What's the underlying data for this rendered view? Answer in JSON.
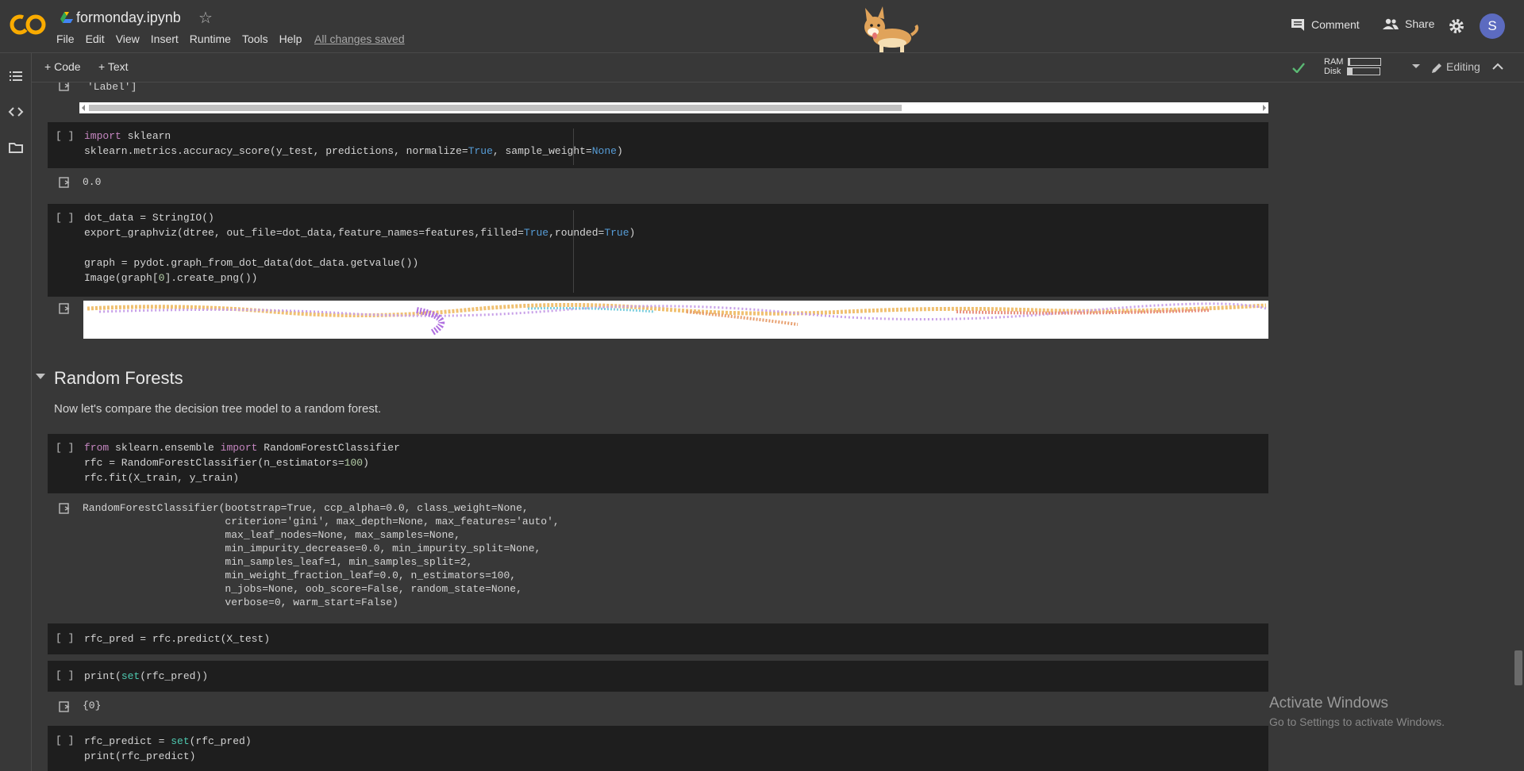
{
  "app": {
    "title": "formonday.ipynb",
    "logo_text": "CO",
    "menu": [
      "File",
      "Edit",
      "View",
      "Insert",
      "Runtime",
      "Tools",
      "Help"
    ],
    "save_status": "All changes saved"
  },
  "topbar_right": {
    "comment_label": "Comment",
    "share_label": "Share",
    "avatar_letter": "S"
  },
  "toolbar": {
    "add_code_label": "Code",
    "add_text_label": "Text",
    "ram_label": "RAM",
    "disk_label": "Disk",
    "ram_usage": 0.05,
    "disk_usage": 0.15,
    "editing_label": "Editing"
  },
  "cells": {
    "prev_output_tail": "'Label']",
    "c1_bracket": "[ ]",
    "c1_l1_kw": "import",
    "c1_l1_rest": " sklearn",
    "c1_l2_a": "sklearn.metrics.accuracy_score(y_test, predictions, normalize=",
    "c1_l2_true": "True",
    "c1_l2_b": ", sample_weight=",
    "c1_l2_none": "None",
    "c1_l2_c": ")",
    "c1_output": "0.0",
    "c2_bracket": "[ ]",
    "c2_l1": "dot_data = StringIO()",
    "c2_l2_a": "export_graphviz(dtree, out_file=dot_data,feature_names=features,filled=",
    "c2_l2_true1": "True",
    "c2_l2_b": ",rounded=",
    "c2_l2_true2": "True",
    "c2_l2_c": ")",
    "c2_l3": "graph = pydot.graph_from_dot_data(dot_data.getvalue())",
    "c2_l4_a": "Image(graph[",
    "c2_l4_num": "0",
    "c2_l4_b": "].create_png())",
    "section_title": "Random Forests",
    "section_text": "Now let's compare the decision tree model to a random forest.",
    "c3_bracket": "[ ]",
    "c3_l1_kw1": "from",
    "c3_l1_mid": " sklearn.ensemble ",
    "c3_l1_kw2": "import",
    "c3_l1_rest": " RandomForestClassifier",
    "c3_l2_a": "rfc = RandomForestClassifier(n_estimators=",
    "c3_l2_num": "100",
    "c3_l2_b": ")",
    "c3_l3": "rfc.fit(X_train, y_train)",
    "c3_output": [
      "RandomForestClassifier(bootstrap=True, ccp_alpha=0.0, class_weight=None,",
      "                       criterion='gini', max_depth=None, max_features='auto',",
      "                       max_leaf_nodes=None, max_samples=None,",
      "                       min_impurity_decrease=0.0, min_impurity_split=None,",
      "                       min_samples_leaf=1, min_samples_split=2,",
      "                       min_weight_fraction_leaf=0.0, n_estimators=100,",
      "                       n_jobs=None, oob_score=False, random_state=None,",
      "                       verbose=0, warm_start=False)"
    ],
    "c4_bracket": "[ ]",
    "c4_l1": "rfc_pred = rfc.predict(X_test)",
    "c5_bracket": "[ ]",
    "c5_l1_a": "print(",
    "c5_l1_set": "set",
    "c5_l1_b": "(rfc_pred))",
    "c5_output": "{0}",
    "c6_bracket": "[ ]",
    "c6_l1_a": "rfc_predict = ",
    "c6_l1_set": "set",
    "c6_l1_b": "(rfc_pred)",
    "c6_l2": "print(rfc_predict)"
  },
  "watermark": {
    "line1": "Activate Windows",
    "line2": "Go to Settings to activate Windows."
  },
  "colors": {
    "keyword": "#c586c0",
    "constant": "#569cd6",
    "number": "#b5cea8",
    "builtin": "#4ec9b0",
    "accent_logo": "#f9ab00"
  }
}
